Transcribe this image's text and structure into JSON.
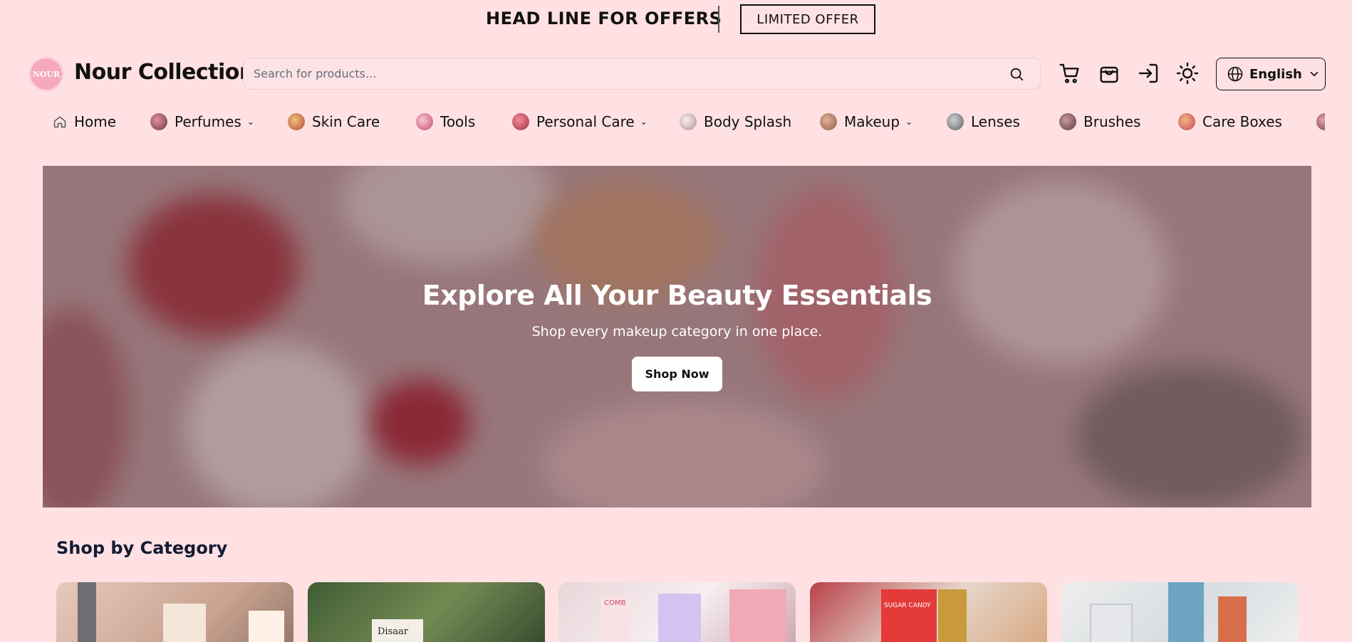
{
  "topbar": {
    "headline": "HEAD LINE FOR OFFERS",
    "offer_button": "LIMITED OFFER"
  },
  "header": {
    "logo_text": "NOUR",
    "brand": "Nour Collection",
    "search_placeholder": "Search for products...",
    "language": "English"
  },
  "nav": {
    "items": [
      {
        "label": "Home",
        "icon": "home-icon"
      },
      {
        "label": "Perfumes",
        "has_dropdown": true
      },
      {
        "label": "Skin Care"
      },
      {
        "label": "Tools"
      },
      {
        "label": "Personal Care",
        "has_dropdown": true
      },
      {
        "label": "Body Splash"
      },
      {
        "label": "Makeup",
        "has_dropdown": true
      },
      {
        "label": "Lenses"
      },
      {
        "label": "Brushes"
      },
      {
        "label": "Care Boxes"
      }
    ]
  },
  "hero": {
    "title": "Explore All Your Beauty Essentials",
    "subtitle": "Shop every makeup category in one place.",
    "cta": "Shop Now"
  },
  "categories": {
    "title": "Shop by Category",
    "card_images": [
      "Disaar",
      "COMB",
      "SUGAR CANDY"
    ]
  },
  "colors": {
    "background": "#ffe1e3",
    "accent": "#f6a8bd"
  }
}
